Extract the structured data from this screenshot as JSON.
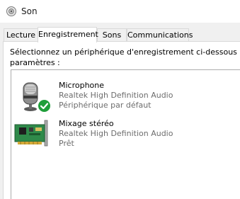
{
  "window": {
    "title": "Son",
    "icon": "speaker-icon"
  },
  "tabs": [
    {
      "label": "Lecture",
      "active": false
    },
    {
      "label": "Enregistrement",
      "active": true
    },
    {
      "label": "Sons",
      "active": false
    },
    {
      "label": "Communications",
      "active": false
    }
  ],
  "panel": {
    "instructions_line1": "Sélectionnez un périphérique d'enregistrement ci-dessous pou",
    "instructions_line2": "paramètres :"
  },
  "devices": [
    {
      "name": "Microphone",
      "driver": "Realtek High Definition Audio",
      "status": "Périphérique par défaut",
      "icon": "microphone-icon",
      "badge": "default-checkmark-icon"
    },
    {
      "name": "Mixage stéréo",
      "driver": "Realtek High Definition Audio",
      "status": "Prêt",
      "icon": "sound-card-icon"
    }
  ],
  "colors": {
    "check_green": "#1f9e3a",
    "pcb_green": "#2f8a4a",
    "secondary_text": "#6d6d6d"
  }
}
